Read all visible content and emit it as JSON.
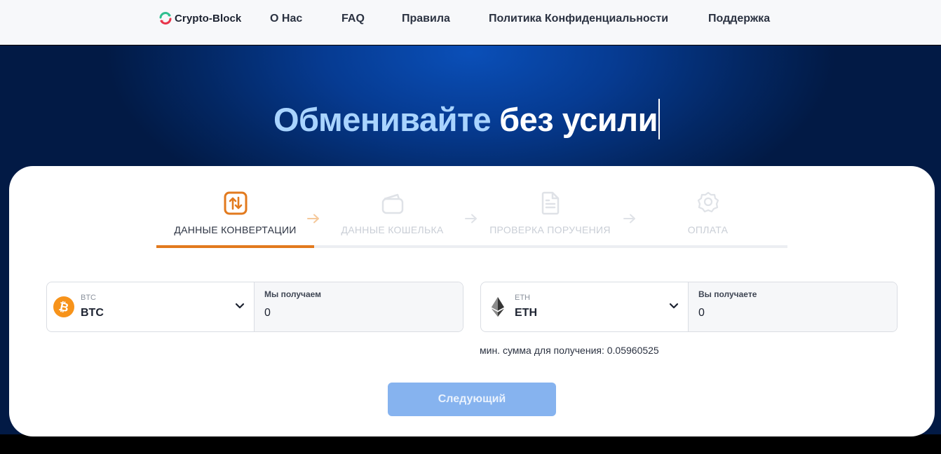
{
  "brand": {
    "name": "Crypto-Block"
  },
  "nav": {
    "about": "О Нас",
    "faq": "FAQ",
    "rules": "Правила",
    "privacy": "Политика Конфиденциальности",
    "support": "Поддержка"
  },
  "hero": {
    "title_part1": "Обменивайте",
    "title_part2": "без усили"
  },
  "steps": [
    {
      "label": "ДАННЫЕ КОНВЕРТАЦИИ",
      "icon": "swap-icon",
      "state": "active"
    },
    {
      "label": "ДАННЫЕ КОШЕЛЬКА",
      "icon": "wallet-icon",
      "state": "inactive"
    },
    {
      "label": "ПРОВЕРКА ПОРУЧЕНИЯ",
      "icon": "document-icon",
      "state": "inactive"
    },
    {
      "label": "ОПЛАТА",
      "icon": "award-icon",
      "state": "inactive"
    }
  ],
  "send": {
    "currency_small": "BTC",
    "currency": "BTC",
    "amount_label": "Мы получаем",
    "amount_value": "0",
    "icon": "bitcoin-icon"
  },
  "receive": {
    "currency_small": "ETH",
    "currency": "ETH",
    "amount_label": "Вы получаете",
    "amount_value": "0",
    "icon": "ethereum-icon"
  },
  "min_note": "мин. сумма для получения: 0.05960525",
  "next_button": "Следующий",
  "colors": {
    "accent": "#e27a1e",
    "hero_highlight": "#a9d4ff",
    "button": "#86b3ef",
    "bitcoin": "#f7931a"
  }
}
